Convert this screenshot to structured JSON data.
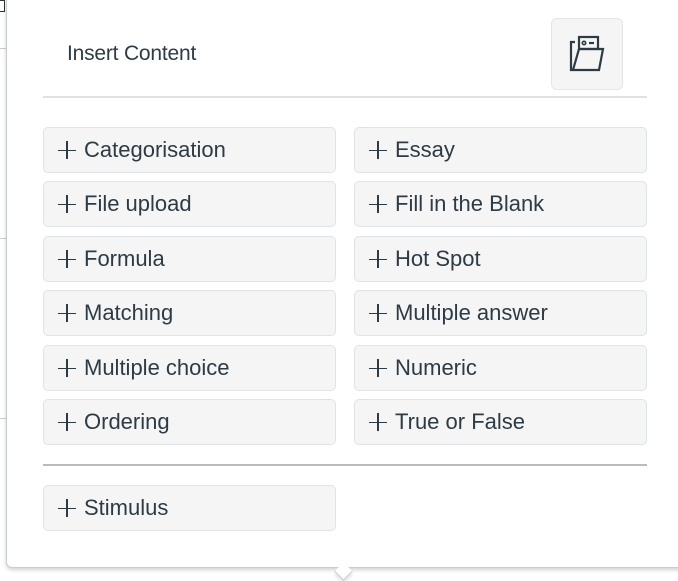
{
  "popover": {
    "title": "Insert Content",
    "item_bank_button": {
      "icon": "folder-open-icon"
    }
  },
  "question_types": [
    {
      "label": "Categorisation",
      "icon": "plus-icon"
    },
    {
      "label": "Essay",
      "icon": "plus-icon"
    },
    {
      "label": "File upload",
      "icon": "plus-icon"
    },
    {
      "label": "Fill in the Blank",
      "icon": "plus-icon"
    },
    {
      "label": "Formula",
      "icon": "plus-icon"
    },
    {
      "label": "Hot Spot",
      "icon": "plus-icon"
    },
    {
      "label": "Matching",
      "icon": "plus-icon"
    },
    {
      "label": "Multiple answer",
      "icon": "plus-icon"
    },
    {
      "label": "Multiple choice",
      "icon": "plus-icon"
    },
    {
      "label": "Numeric",
      "icon": "plus-icon"
    },
    {
      "label": "Ordering",
      "icon": "plus-icon"
    },
    {
      "label": "True or False",
      "icon": "plus-icon"
    }
  ],
  "other_content": [
    {
      "label": "Stimulus",
      "icon": "plus-icon"
    }
  ]
}
